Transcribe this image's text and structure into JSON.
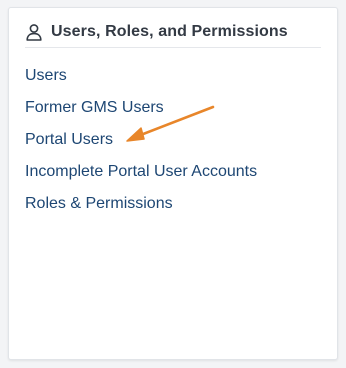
{
  "panel": {
    "title": "Users, Roles, and Permissions",
    "icon": "user-icon"
  },
  "links": [
    {
      "label": "Users",
      "name": "link-users"
    },
    {
      "label": "Former GMS Users",
      "name": "link-former-gms-users"
    },
    {
      "label": "Portal Users",
      "name": "link-portal-users"
    },
    {
      "label": "Incomplete Portal User Accounts",
      "name": "link-incomplete-portal-user-accounts"
    },
    {
      "label": "Roles & Permissions",
      "name": "link-roles-permissions"
    }
  ],
  "colors": {
    "link": "#1d4673",
    "title": "#333a44",
    "annotation_arrow": "#e8862a"
  }
}
